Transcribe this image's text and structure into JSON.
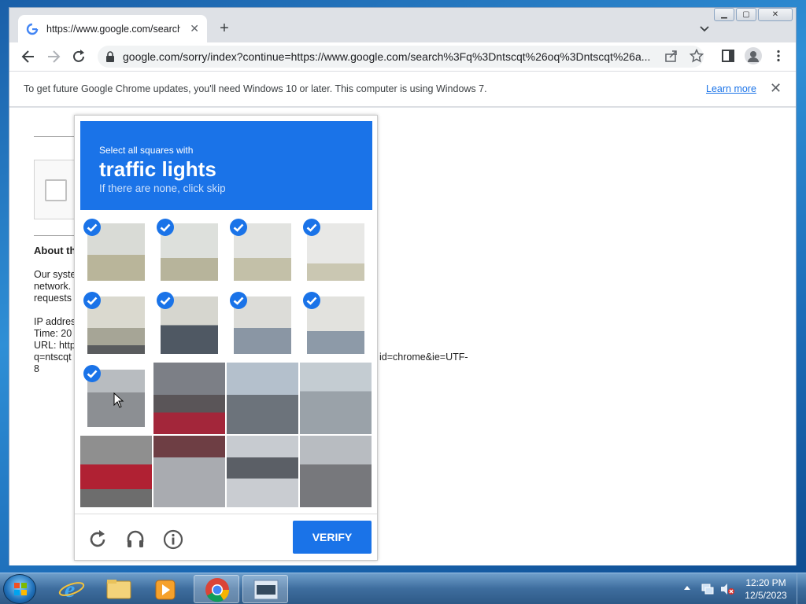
{
  "browser": {
    "tab_title": "https://www.google.com/search?",
    "address_url": "google.com/sorry/index?continue=https://www.google.com/search%3Fq%3Dntscqt%26oq%3Dntscqt%26a...",
    "infobar_message": "To get future Google Chrome updates, you'll need Windows 10 or later. This computer is using Windows 7.",
    "infobar_link": "Learn more"
  },
  "page": {
    "about_heading": "About th",
    "line1": "Our syste",
    "line2": "network.",
    "line3": "requests",
    "ip_label": "IP addres",
    "time_label": "Time: 20",
    "url_label": "URL: http",
    "url_cont": "q=ntscqt",
    "url_tail": "8",
    "url_right": "id=chrome&ie=UTF-"
  },
  "captcha": {
    "instruction": "Select all squares with",
    "target": "traffic lights",
    "hint": "If there are none, click skip",
    "verify_label": "VERIFY",
    "tiles": [
      {
        "selected": true,
        "icon": "traffic-light-red"
      },
      {
        "selected": true,
        "icon": "traffic-light-green"
      },
      {
        "selected": true,
        "icon": "traffic-light-pole"
      },
      {
        "selected": true,
        "icon": "sky-pole"
      },
      {
        "selected": true,
        "icon": "sky-horizon"
      },
      {
        "selected": true,
        "icon": "store-sign"
      },
      {
        "selected": true,
        "icon": "building"
      },
      {
        "selected": true,
        "icon": "lamp-post"
      },
      {
        "selected": true,
        "icon": "road"
      },
      {
        "selected": false,
        "icon": "car-roof"
      },
      {
        "selected": false,
        "icon": "street-scene"
      },
      {
        "selected": false,
        "icon": "traffic-light-car"
      },
      {
        "selected": false,
        "icon": "car-rear"
      },
      {
        "selected": false,
        "icon": "car-side"
      },
      {
        "selected": false,
        "icon": "car-back"
      },
      {
        "selected": false,
        "icon": "car-corner"
      }
    ]
  },
  "taskbar": {
    "time": "12:20 PM",
    "date": "12/5/2023"
  },
  "colors": {
    "accent": "#1a73e8"
  }
}
